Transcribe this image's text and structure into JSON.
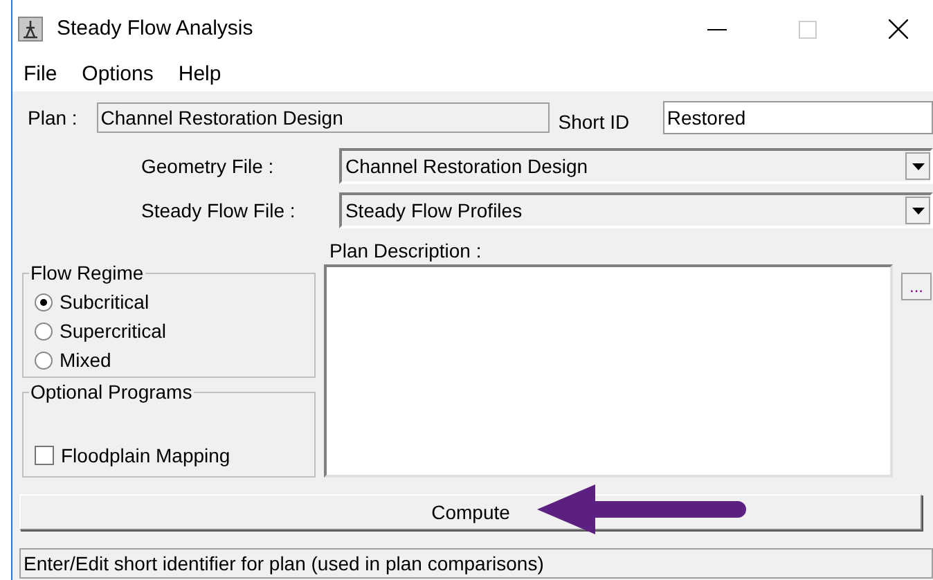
{
  "window": {
    "title": "Steady Flow Analysis"
  },
  "menu": [
    "File",
    "Options",
    "Help"
  ],
  "plan": {
    "label": "Plan :",
    "value": "Channel Restoration Design"
  },
  "short_id": {
    "label": "Short ID",
    "value": "Restored"
  },
  "geometry_file": {
    "label": "Geometry File :",
    "value": "Channel Restoration Design"
  },
  "steady_flow_file": {
    "label": "Steady Flow File :",
    "value": "Steady Flow Profiles"
  },
  "flow_regime": {
    "title": "Flow Regime",
    "options": [
      {
        "label": "Subcritical",
        "selected": true
      },
      {
        "label": "Supercritical",
        "selected": false
      },
      {
        "label": "Mixed",
        "selected": false
      }
    ]
  },
  "optional_programs": {
    "title": "Optional Programs",
    "items": [
      {
        "label": "Floodplain Mapping",
        "checked": false
      }
    ]
  },
  "plan_description": {
    "label": "Plan Description :",
    "more_button": "..."
  },
  "compute_button": "Compute",
  "status_bar": "Enter/Edit short identifier for plan (used in plan comparisons)"
}
